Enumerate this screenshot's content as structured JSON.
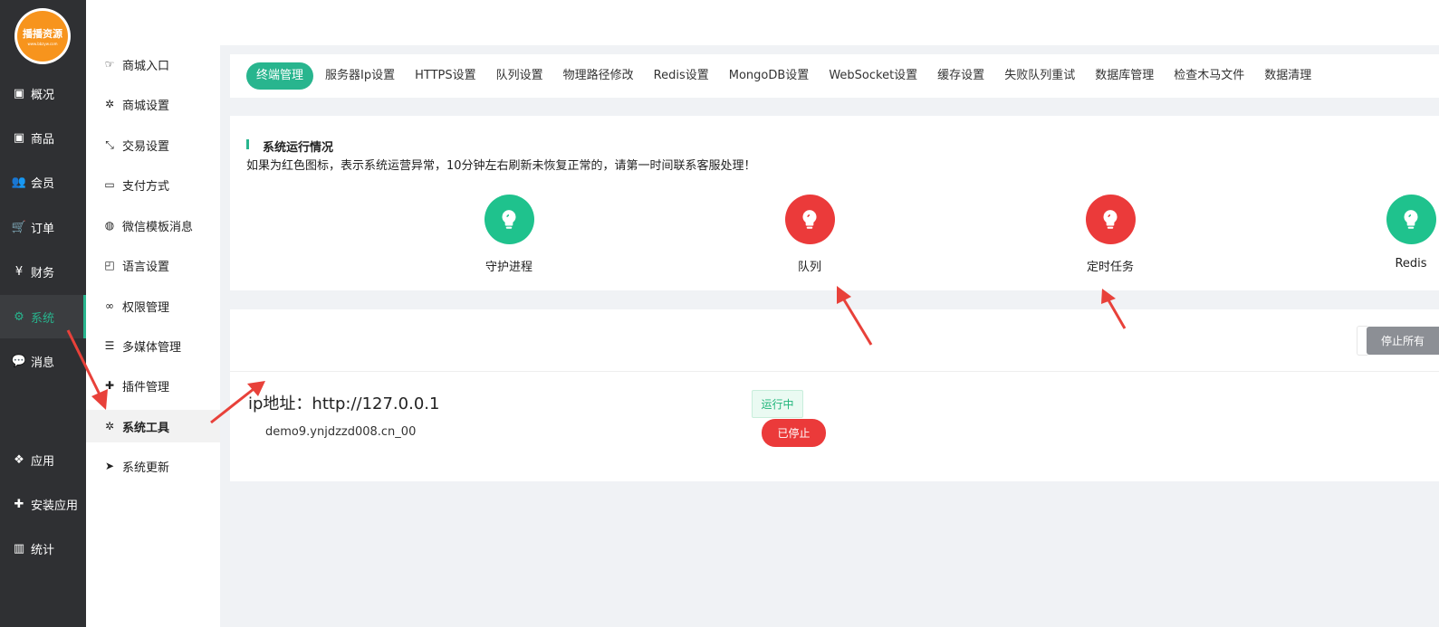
{
  "logo": {
    "text": "播播资源",
    "subtext": "www.bbzyw.com",
    "color": "#f7941d"
  },
  "sidebar": {
    "items": [
      {
        "label": "概况",
        "icon": "dashboard-icon",
        "glyph": "▣",
        "active": false
      },
      {
        "label": "商品",
        "icon": "box-icon",
        "glyph": "▣",
        "active": false
      },
      {
        "label": "会员",
        "icon": "users-icon",
        "glyph": "👥",
        "active": false
      },
      {
        "label": "订单",
        "icon": "cart-icon",
        "glyph": "🛒",
        "active": false
      },
      {
        "label": "财务",
        "icon": "yen-icon",
        "glyph": "¥",
        "active": false
      },
      {
        "label": "系统",
        "icon": "gears-icon",
        "glyph": "⚙",
        "active": true
      },
      {
        "label": "消息",
        "icon": "chat-icon",
        "glyph": "💬",
        "active": false
      },
      {
        "label": "应用",
        "icon": "cubes-icon",
        "glyph": "❖",
        "active": false
      },
      {
        "label": "安装应用",
        "icon": "puzzle-icon",
        "glyph": "✚",
        "active": false
      },
      {
        "label": "统计",
        "icon": "bar-chart-icon",
        "glyph": "▥",
        "active": false
      }
    ]
  },
  "subnav": {
    "items": [
      {
        "label": "商城入口",
        "icon": "hand-pointer-icon",
        "glyph": "☞",
        "active": false
      },
      {
        "label": "商城设置",
        "icon": "gear-icon",
        "glyph": "✲",
        "active": false
      },
      {
        "label": "交易设置",
        "icon": "compress-icon",
        "glyph": "⤡",
        "active": false
      },
      {
        "label": "支付方式",
        "icon": "credit-card-icon",
        "glyph": "▭",
        "active": false
      },
      {
        "label": "微信模板消息",
        "icon": "wechat-icon",
        "glyph": "◍",
        "active": false
      },
      {
        "label": "语言设置",
        "icon": "translate-icon",
        "glyph": "◰",
        "active": false
      },
      {
        "label": "权限管理",
        "icon": "mask-icon",
        "glyph": "∞",
        "active": false
      },
      {
        "label": "多媒体管理",
        "icon": "list-icon",
        "glyph": "☰",
        "active": false
      },
      {
        "label": "插件管理",
        "icon": "plugin-icon",
        "glyph": "✚",
        "active": false
      },
      {
        "label": "系统工具",
        "icon": "gear-icon",
        "glyph": "✲",
        "active": true
      },
      {
        "label": "系统更新",
        "icon": "paper-plane-icon",
        "glyph": "➤",
        "active": false
      }
    ]
  },
  "tabs": [
    {
      "label": "终端管理",
      "active": true
    },
    {
      "label": "服务器Ip设置",
      "active": false
    },
    {
      "label": "HTTPS设置",
      "active": false
    },
    {
      "label": "队列设置",
      "active": false
    },
    {
      "label": "物理路径修改",
      "active": false
    },
    {
      "label": "Redis设置",
      "active": false
    },
    {
      "label": "MongoDB设置",
      "active": false
    },
    {
      "label": "WebSocket设置",
      "active": false
    },
    {
      "label": "缓存设置",
      "active": false
    },
    {
      "label": "失败队列重试",
      "active": false
    },
    {
      "label": "数据库管理",
      "active": false
    },
    {
      "label": "检查木马文件",
      "active": false
    },
    {
      "label": "数据清理",
      "active": false
    }
  ],
  "status_card": {
    "title": "系统运行情况",
    "description": "如果为红色图标，表示系统运营异常，10分钟左右刷新未恢复正常的，请第一时间联系客服处理！",
    "items": [
      {
        "label": "守护进程",
        "state": "green",
        "icon": "lightbulb-icon"
      },
      {
        "label": "队列",
        "state": "red",
        "icon": "lightbulb-icon"
      },
      {
        "label": "定时任务",
        "state": "red",
        "icon": "lightbulb-icon"
      },
      {
        "label": "Redis",
        "state": "green",
        "icon": "lightbulb-icon"
      }
    ]
  },
  "terminal": {
    "stop_all_label": "停止所有",
    "ip_label": "ip地址：http://127.0.0.1",
    "host": "demo9.ynjdzzd008.cn_00",
    "running_badge": "运行中",
    "stopped_button": "已停止"
  },
  "colors": {
    "accent": "#28b58e",
    "danger": "#eb3a3a",
    "success": "#1fc28d",
    "sidebar_bg": "#2f3033"
  }
}
